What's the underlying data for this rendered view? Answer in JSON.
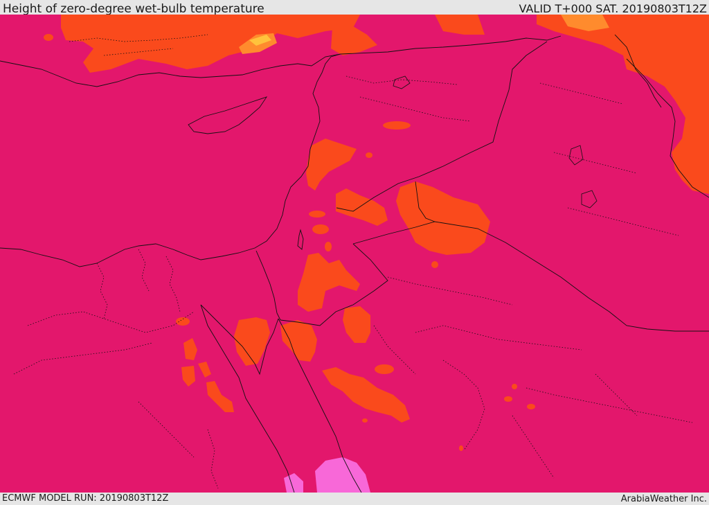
{
  "header": {
    "title": "Height of zero-degree wet-bulb temperature",
    "valid_time": "VALID T+000 SAT. 20190803T12Z"
  },
  "footer": {
    "model_run": "ECMWF MODEL RUN: 20190803T12Z",
    "credit": "ArabiaWeather Inc."
  },
  "map": {
    "region": "Eastern Mediterranean, Levant, Iraq, northern Arabia and Egypt",
    "colors": {
      "background_field": "#e3176c",
      "field_orange": "#fa4a1c",
      "field_light_orange": "#ff8b2d",
      "field_yellow": "#ffc23c",
      "field_pink": "#f868d8",
      "coastline": "#111111",
      "borders": "#111111"
    }
  }
}
